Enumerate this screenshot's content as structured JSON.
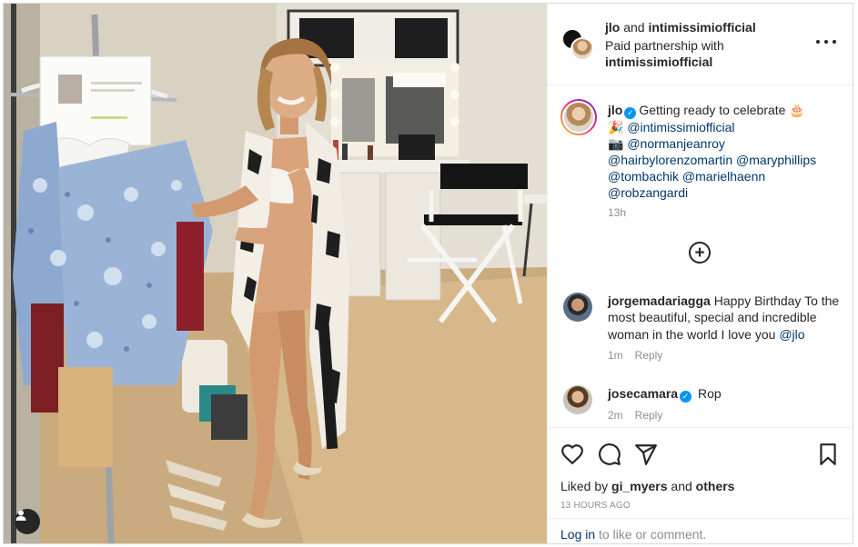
{
  "post": {
    "header": {
      "author": "jlo",
      "joiner": " and ",
      "coauthor": "intimissimiofficial",
      "paid_label": "Paid partnership with",
      "partner": "intimissimiofficial"
    },
    "caption": {
      "username": "jlo",
      "text": "Getting ready to celebrate 🎂",
      "lines": [
        "🎉 @intimissimiofficial",
        "📷 @normanjeanroy",
        "@hairbylorenzomartin @maryphillips",
        "@tombachik @marielhaenn",
        "@robzangardi"
      ],
      "time": "13h"
    },
    "comments": [
      {
        "username": "jorgemadariagga",
        "text": "Happy Birthday To the most beautiful, special and incredible woman in the world I love you ",
        "mention": "@jlo",
        "time": "1m",
        "reply": "Reply"
      },
      {
        "username": "josecamara",
        "text": "Rop",
        "time": "2m",
        "reply": "Reply"
      }
    ],
    "likes": {
      "prefix": "Liked by ",
      "user": "gi_myers",
      "joiner": " and ",
      "others": "others"
    },
    "timestamp": "13 HOURS AGO",
    "login": {
      "link": "Log in",
      "rest": " to like or comment."
    }
  },
  "icons": {
    "more": "more-options-icon",
    "load_more": "plus-circle-icon",
    "like": "heart-icon",
    "comment": "comment-bubble-icon",
    "share": "paper-plane-icon",
    "save": "bookmark-icon",
    "tag": "user-tag-icon",
    "verified": "verified-badge-icon"
  },
  "colors": {
    "link": "#00376b",
    "verified": "#0095f6",
    "muted": "#8e8e8e",
    "text": "#262626"
  }
}
